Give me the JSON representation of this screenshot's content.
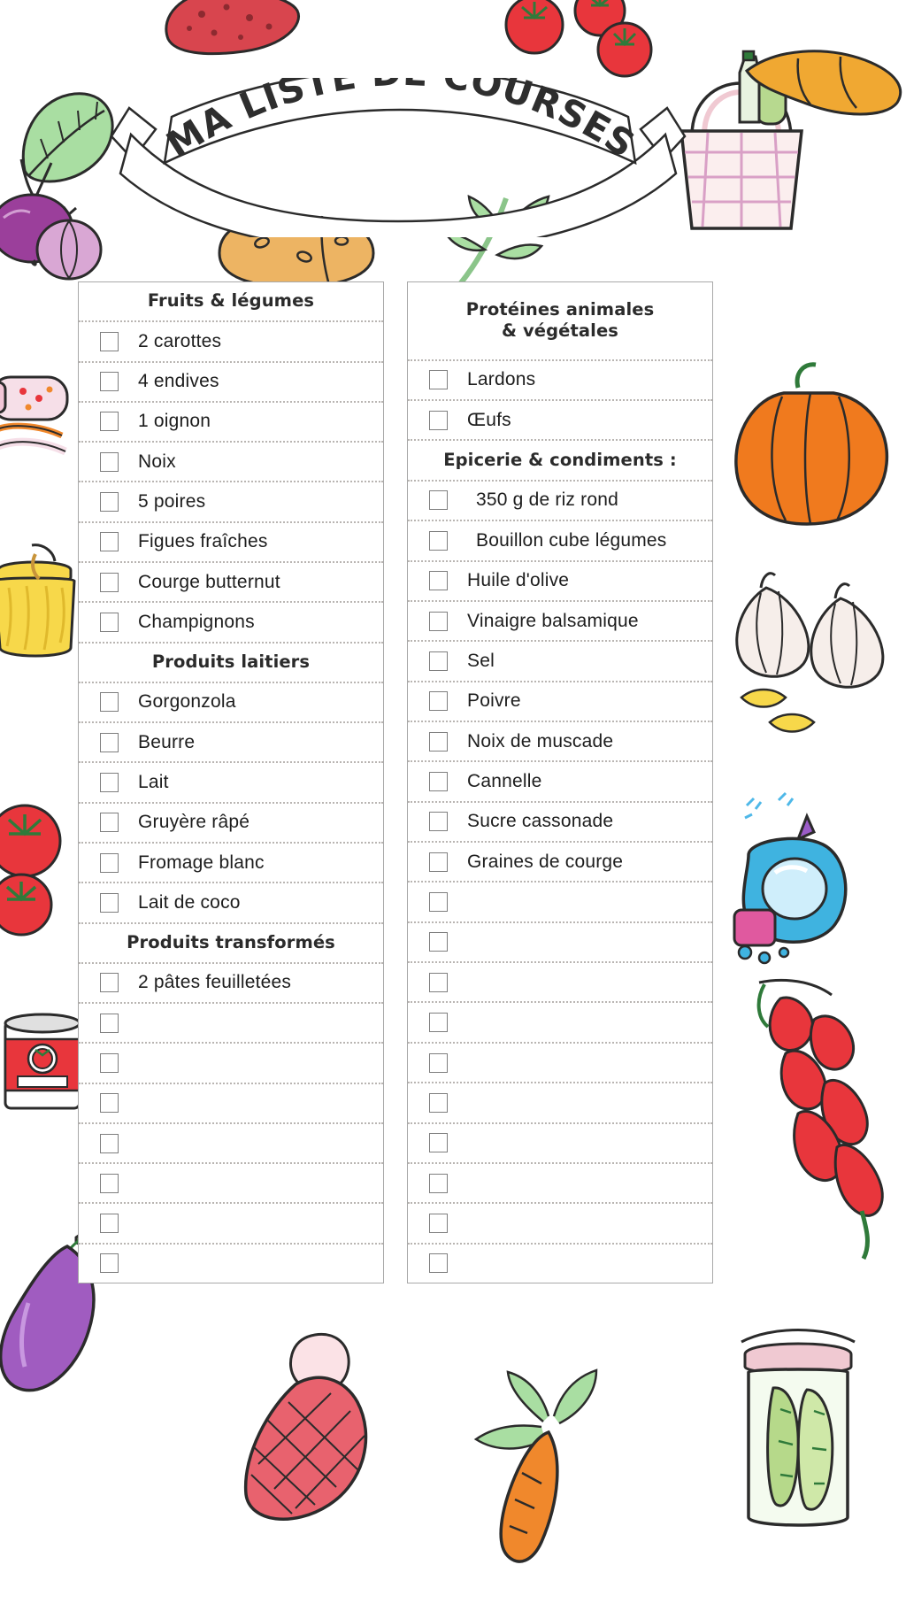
{
  "document": {
    "title": "MA LISTE DE COURSES",
    "title_letters": [
      "M",
      "A",
      " ",
      "L",
      "I",
      "S",
      "T",
      "E",
      " ",
      "D",
      "E",
      " ",
      "C",
      "O",
      "U",
      "R",
      "S",
      "E",
      "S"
    ],
    "language": "fr"
  },
  "colors": {
    "ink": "#2b2b2b",
    "panel_border": "#a8a8a8",
    "row_divider": "#b9b5b2",
    "checkbox_border": "#7e7e7e",
    "tomato_red": "#e8363c",
    "carrot_orange": "#f0882c",
    "pumpkin_orange": "#f07a1e",
    "leaf_green": "#8bc58a",
    "eggplant_purple": "#a05cc0",
    "beet_purple": "#9b3f9b",
    "potato_tan": "#edb463",
    "jar_yellow": "#f7d84a",
    "onion_pink": "#e8a6c8",
    "garlic_white": "#f3eae6",
    "bottle_blue": "#3fb3e0",
    "basket_pink": "#f8e3e3",
    "sausage_red": "#d8454e",
    "ham_pink": "#f4b9c4",
    "pickle_green": "#b6d98a"
  },
  "columns": [
    {
      "name": "left-column",
      "rows": [
        {
          "type": "header",
          "label": "Fruits & légumes",
          "tall": false
        },
        {
          "type": "item",
          "label": "2 carottes",
          "checked": false,
          "indent": 1
        },
        {
          "type": "item",
          "label": "4 endives",
          "checked": false,
          "indent": 1
        },
        {
          "type": "item",
          "label": "1  oignon",
          "checked": false,
          "indent": 1
        },
        {
          "type": "item",
          "label": "Noix",
          "checked": false,
          "indent": 1
        },
        {
          "type": "item",
          "label": "5 poires",
          "checked": false,
          "indent": 1
        },
        {
          "type": "item",
          "label": "Figues fraîches",
          "checked": false,
          "indent": 1
        },
        {
          "type": "item",
          "label": "Courge butternut",
          "checked": false,
          "indent": 1
        },
        {
          "type": "item",
          "label": "Champignons",
          "checked": false,
          "indent": 1
        },
        {
          "type": "header",
          "label": "Produits laitiers",
          "tall": false
        },
        {
          "type": "item",
          "label": "Gorgonzola",
          "checked": false,
          "indent": 1
        },
        {
          "type": "item",
          "label": "Beurre",
          "checked": false,
          "indent": 1
        },
        {
          "type": "item",
          "label": "Lait",
          "checked": false,
          "indent": 1
        },
        {
          "type": "item",
          "label": "Gruyère râpé",
          "checked": false,
          "indent": 1
        },
        {
          "type": "item",
          "label": "Fromage blanc",
          "checked": false,
          "indent": 1
        },
        {
          "type": "item",
          "label": "Lait de coco",
          "checked": false,
          "indent": 1
        },
        {
          "type": "header",
          "label": "Produits transformés",
          "tall": false
        },
        {
          "type": "item",
          "label": "2 pâtes feuilletées",
          "checked": false,
          "indent": 1
        },
        {
          "type": "item",
          "label": "",
          "checked": false,
          "indent": 1
        },
        {
          "type": "item",
          "label": "",
          "checked": false,
          "indent": 1
        },
        {
          "type": "item",
          "label": "",
          "checked": false,
          "indent": 1
        },
        {
          "type": "item",
          "label": "",
          "checked": false,
          "indent": 1
        },
        {
          "type": "item",
          "label": "",
          "checked": false,
          "indent": 1
        },
        {
          "type": "item",
          "label": "",
          "checked": false,
          "indent": 1
        },
        {
          "type": "item",
          "label": "",
          "checked": false,
          "indent": 1
        }
      ]
    },
    {
      "name": "right-column",
      "rows": [
        {
          "type": "header",
          "label": "Protéines animales\n& végétales",
          "tall": true
        },
        {
          "type": "item",
          "label": "Lardons",
          "checked": false,
          "indent": 1
        },
        {
          "type": "item",
          "label": "Œufs",
          "checked": false,
          "indent": 1
        },
        {
          "type": "header",
          "label": "Epicerie & condiments :",
          "tall": false
        },
        {
          "type": "item",
          "label": "350 g de riz rond",
          "checked": false,
          "indent": 2
        },
        {
          "type": "item",
          "label": "Bouillon cube légumes",
          "checked": false,
          "indent": 2
        },
        {
          "type": "item",
          "label": "Huile d'olive",
          "checked": false,
          "indent": 1
        },
        {
          "type": "item",
          "label": "Vinaigre balsamique",
          "checked": false,
          "indent": 1
        },
        {
          "type": "item",
          "label": "Sel",
          "checked": false,
          "indent": 1
        },
        {
          "type": "item",
          "label": "Poivre",
          "checked": false,
          "indent": 1
        },
        {
          "type": "item",
          "label": "Noix de muscade",
          "checked": false,
          "indent": 1
        },
        {
          "type": "item",
          "label": "Cannelle",
          "checked": false,
          "indent": 1
        },
        {
          "type": "item",
          "label": "Sucre cassonade",
          "checked": false,
          "indent": 1
        },
        {
          "type": "item",
          "label": "Graines de courge",
          "checked": false,
          "indent": 1
        },
        {
          "type": "item",
          "label": "",
          "checked": false,
          "indent": 1
        },
        {
          "type": "item",
          "label": "",
          "checked": false,
          "indent": 1
        },
        {
          "type": "item",
          "label": "",
          "checked": false,
          "indent": 1
        },
        {
          "type": "item",
          "label": "",
          "checked": false,
          "indent": 1
        },
        {
          "type": "item",
          "label": "",
          "checked": false,
          "indent": 1
        },
        {
          "type": "item",
          "label": "",
          "checked": false,
          "indent": 1
        },
        {
          "type": "item",
          "label": "",
          "checked": false,
          "indent": 1
        },
        {
          "type": "item",
          "label": "",
          "checked": false,
          "indent": 1
        },
        {
          "type": "item",
          "label": "",
          "checked": false,
          "indent": 1
        },
        {
          "type": "item",
          "label": "",
          "checked": false,
          "indent": 1
        }
      ]
    }
  ],
  "decorations": [
    {
      "name": "sausage-illustration",
      "position": "top-left"
    },
    {
      "name": "chard-leaf-illustration",
      "position": "left-top"
    },
    {
      "name": "beetroot-illustration",
      "position": "left-upper"
    },
    {
      "name": "onion-illustration",
      "position": "left-upper"
    },
    {
      "name": "potato-illustration",
      "position": "top-center"
    },
    {
      "name": "tomato-illustration",
      "position": "top-center-right"
    },
    {
      "name": "carrot-greens-illustration",
      "position": "top-right-center"
    },
    {
      "name": "picnic-basket-illustration",
      "position": "top-right"
    },
    {
      "name": "sausage-link-illustration",
      "position": "top-right-corner"
    },
    {
      "name": "sauce-bottle-illustration",
      "position": "left-middle"
    },
    {
      "name": "honey-jar-illustration",
      "position": "left-middle-lower"
    },
    {
      "name": "tomatoes-illustration",
      "position": "left-lower"
    },
    {
      "name": "tomato-paste-can-illustration",
      "position": "left-bottom"
    },
    {
      "name": "eggplant-illustration",
      "position": "bottom-left"
    },
    {
      "name": "ham-illustration",
      "position": "bottom-center"
    },
    {
      "name": "carrot-illustration",
      "position": "bottom-center-right"
    },
    {
      "name": "pickle-jar-illustration",
      "position": "bottom-right"
    },
    {
      "name": "pumpkin-illustration",
      "position": "right-upper"
    },
    {
      "name": "garlic-illustration",
      "position": "right-middle"
    },
    {
      "name": "cleaning-spray-illustration",
      "position": "right-lower"
    },
    {
      "name": "chili-peppers-illustration",
      "position": "right-bottom"
    }
  ]
}
